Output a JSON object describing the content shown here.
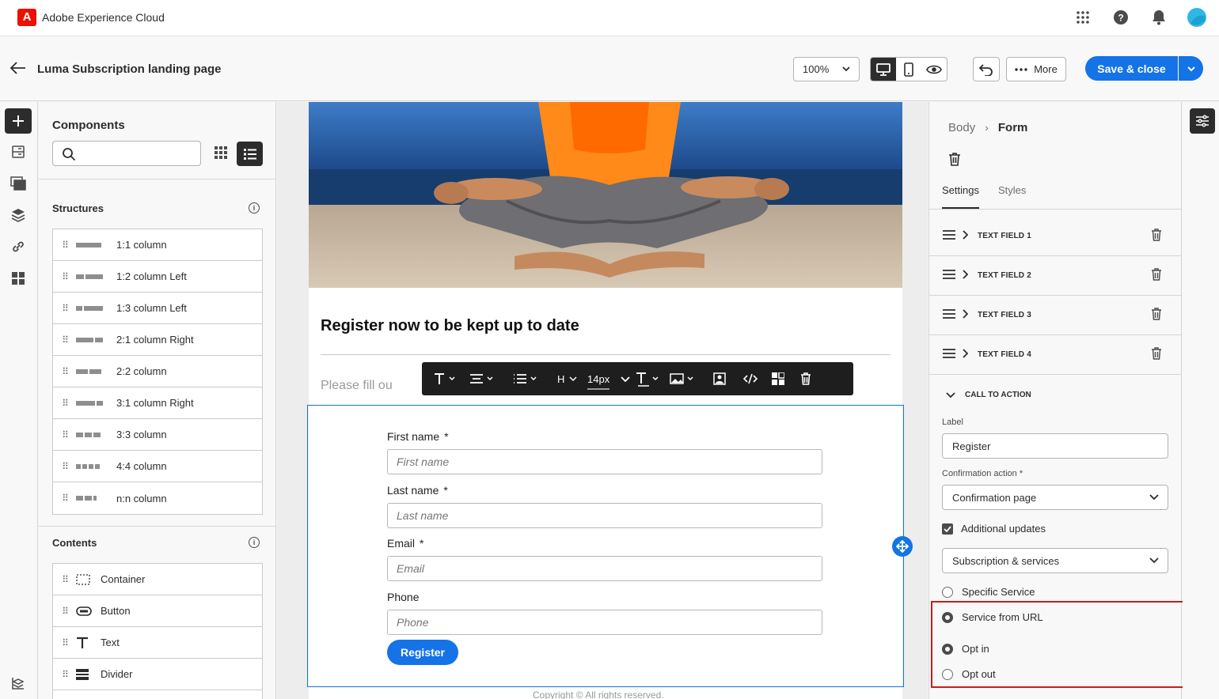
{
  "app": {
    "name": "Adobe Experience Cloud",
    "logo": "A"
  },
  "header": {
    "page_title": "Luma Subscription landing page",
    "zoom": "100%",
    "more_label": "More",
    "save_label": "Save & close"
  },
  "components": {
    "title": "Components",
    "search_placeholder": "",
    "structures_title": "Structures",
    "structures": [
      {
        "label": "1:1 column",
        "thumb": [
          32
        ]
      },
      {
        "label": "1:2 column Left",
        "thumb": [
          10,
          22
        ]
      },
      {
        "label": "1:3 column Left",
        "thumb": [
          8,
          24
        ]
      },
      {
        "label": "2:1 column Right",
        "thumb": [
          22,
          10
        ]
      },
      {
        "label": "2:2 column",
        "thumb": [
          15,
          15
        ]
      },
      {
        "label": "3:1 column Right",
        "thumb": [
          24,
          8
        ]
      },
      {
        "label": "3:3 column",
        "thumb": [
          9,
          9,
          9
        ]
      },
      {
        "label": "4:4 column",
        "thumb": [
          6,
          6,
          6,
          6
        ]
      },
      {
        "label": "n:n column",
        "thumb": [
          9,
          9,
          4
        ]
      }
    ],
    "contents_title": "Contents",
    "contents": [
      {
        "label": "Container",
        "icon": "container-icon"
      },
      {
        "label": "Button",
        "icon": "button-icon"
      },
      {
        "label": "Text",
        "icon": "text-icon"
      },
      {
        "label": "Divider",
        "icon": "divider-icon"
      }
    ]
  },
  "canvas": {
    "heading": "Register now to be kept up to date",
    "intro": "Please fill ou",
    "toolbar": {
      "font_size": "14px",
      "heading": "H"
    },
    "form": {
      "fields": [
        {
          "label": "First name",
          "required": "*",
          "placeholder": "First name"
        },
        {
          "label": "Last name",
          "required": "*",
          "placeholder": "Last name"
        },
        {
          "label": "Email",
          "required": "*",
          "placeholder": "Email"
        },
        {
          "label": "Phone",
          "required": "",
          "placeholder": "Phone"
        }
      ],
      "button": "Register"
    },
    "footer": "Copyright ©  All rights reserved."
  },
  "properties": {
    "breadcrumb_parent": "Body",
    "breadcrumb_current": "Form",
    "tabs": [
      "Settings",
      "Styles"
    ],
    "active_tab": "Settings",
    "fields": [
      "TEXT FIELD 1",
      "TEXT FIELD 2",
      "TEXT FIELD 3",
      "TEXT FIELD 4"
    ],
    "cta_title": "CALL TO ACTION",
    "label_caption": "Label",
    "label_value": "Register",
    "confirmation_caption": "Confirmation action",
    "confirmation_required": "*",
    "confirmation_value": "Confirmation page",
    "additional_updates": "Additional updates",
    "additional_updates_checked": true,
    "subscription_value": "Subscription & services",
    "service_options": [
      {
        "label": "Specific Service",
        "selected": false
      },
      {
        "label": "Service from URL",
        "selected": true
      }
    ],
    "opt_options": [
      {
        "label": "Opt in",
        "selected": true
      },
      {
        "label": "Opt out",
        "selected": false
      }
    ]
  },
  "colors": {
    "accent": "#1473e6",
    "brand": "#eb1000",
    "highlight": "#c41e1e"
  }
}
